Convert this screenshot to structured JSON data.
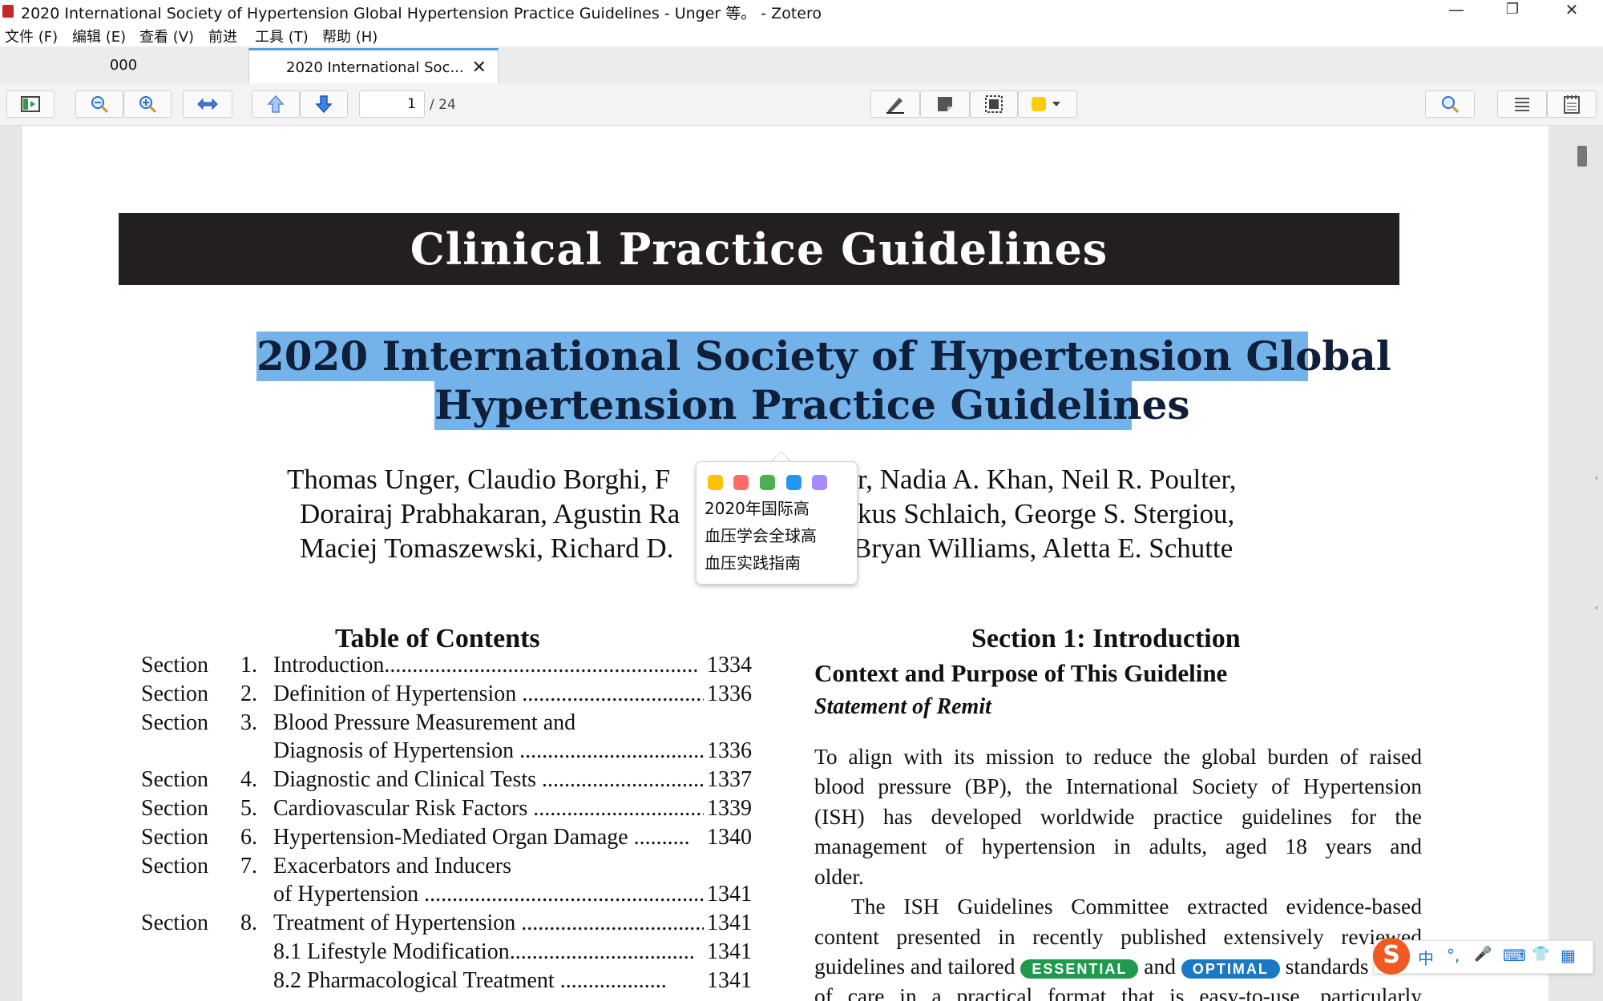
{
  "window": {
    "title": "2020 International Society of Hypertension Global Hypertension Practice Guidelines - Unger 等。 - Zotero",
    "minimize_glyph": "—",
    "restore_glyph": "❐",
    "close_glyph": "✕"
  },
  "menu": [
    "文件 (F)",
    "编辑 (E)",
    "查看 (V)",
    "前进",
    "工具 (T)",
    "帮助 (H)"
  ],
  "tabs": {
    "library": "000",
    "document": "2020 International Soc...",
    "close_glyph": "✕"
  },
  "toolbar": {
    "page_current": "1",
    "page_total": "/ 24",
    "highlight_color": "#ffcc00"
  },
  "pdf": {
    "banner": "Clinical Practice Guidelines",
    "title_line1": "2020 International Society of Hypertension Global",
    "title_line2": "Hypertension Practice Guidelines",
    "authors": [
      "Thomas Unger, Claudio Borghi, F",
      "r, Nadia A. Khan, Neil R. Poulter,",
      "Dorairaj Prabhakaran, Agustin Ra",
      "kus Schlaich, George S. Stergiou,",
      "Maciej Tomaszewski, Richard D.",
      "Bryan Williams, Aletta E. Schutte"
    ],
    "toc_heading": "Table of Contents",
    "toc": [
      {
        "sec": "Section",
        "num": "1.",
        "title": "Introduction........................................................",
        "page": "1334"
      },
      {
        "sec": "Section",
        "num": "2.",
        "title": "Definition of Hypertension ..................................",
        "page": "1336"
      },
      {
        "sec": "Section",
        "num": "3.",
        "title": "Blood Pressure Measurement and",
        "page": ""
      },
      {
        "sec": "",
        "num": "",
        "title": "Diagnosis of Hypertension ...................................",
        "page": "1336"
      },
      {
        "sec": "Section",
        "num": "4.",
        "title": "Diagnostic and Clinical Tests .............................",
        "page": "1337"
      },
      {
        "sec": "Section",
        "num": "5.",
        "title": "Cardiovascular Risk Factors ...............................",
        "page": "1339"
      },
      {
        "sec": "Section",
        "num": "6.",
        "title": "Hypertension-Mediated Organ Damage ..........",
        "page": "1340"
      },
      {
        "sec": "Section",
        "num": "7.",
        "title": "Exacerbators and Inducers",
        "page": ""
      },
      {
        "sec": "",
        "num": "",
        "title": "of Hypertension ...................................................",
        "page": "1341"
      },
      {
        "sec": "Section",
        "num": "8.",
        "title": "Treatment of Hypertension ...................................",
        "page": "1341"
      },
      {
        "sec": "",
        "num": "",
        "title": "   8.1  Lifestyle Modification.................................",
        "page": "1341"
      },
      {
        "sec": "",
        "num": "",
        "title": "   8.2  Pharmacological Treatment ...................",
        "page": "1341"
      }
    ],
    "section_heading": "Section 1: Introduction",
    "sub_heading": "Context and Purpose of This Guideline",
    "italic_heading": "Statement of Remit",
    "body": [
      "To align with its mission to reduce the global burden of raised",
      "blood pressure (BP), the International Society of Hypertension",
      "(ISH) has developed worldwide practice guidelines for the",
      "management of hypertension in adults, aged 18 years and",
      "older.",
      "The ISH Guidelines Committee extracted evidence-based",
      "content presented in recently published extensively reviewed",
      "of care in a practical format that is easy-to-use, particularly"
    ],
    "body_guidelines_prefix": "guidelines and tailored",
    "badge_essential": "ESSENTIAL",
    "body_and": "and",
    "badge_optimal": "OPTIMAL",
    "body_standards": "standards"
  },
  "popup": {
    "colors": [
      "#ffc107",
      "#ff6b6b",
      "#4caf50",
      "#2196f3",
      "#a78bfa"
    ],
    "translation": [
      "2020年国际高",
      "血压学会全球高",
      "血压实践指南"
    ]
  },
  "ime": {
    "logo": "S",
    "items": [
      "中",
      "°,",
      "🎤",
      "⌨",
      "👕",
      "▦"
    ]
  }
}
